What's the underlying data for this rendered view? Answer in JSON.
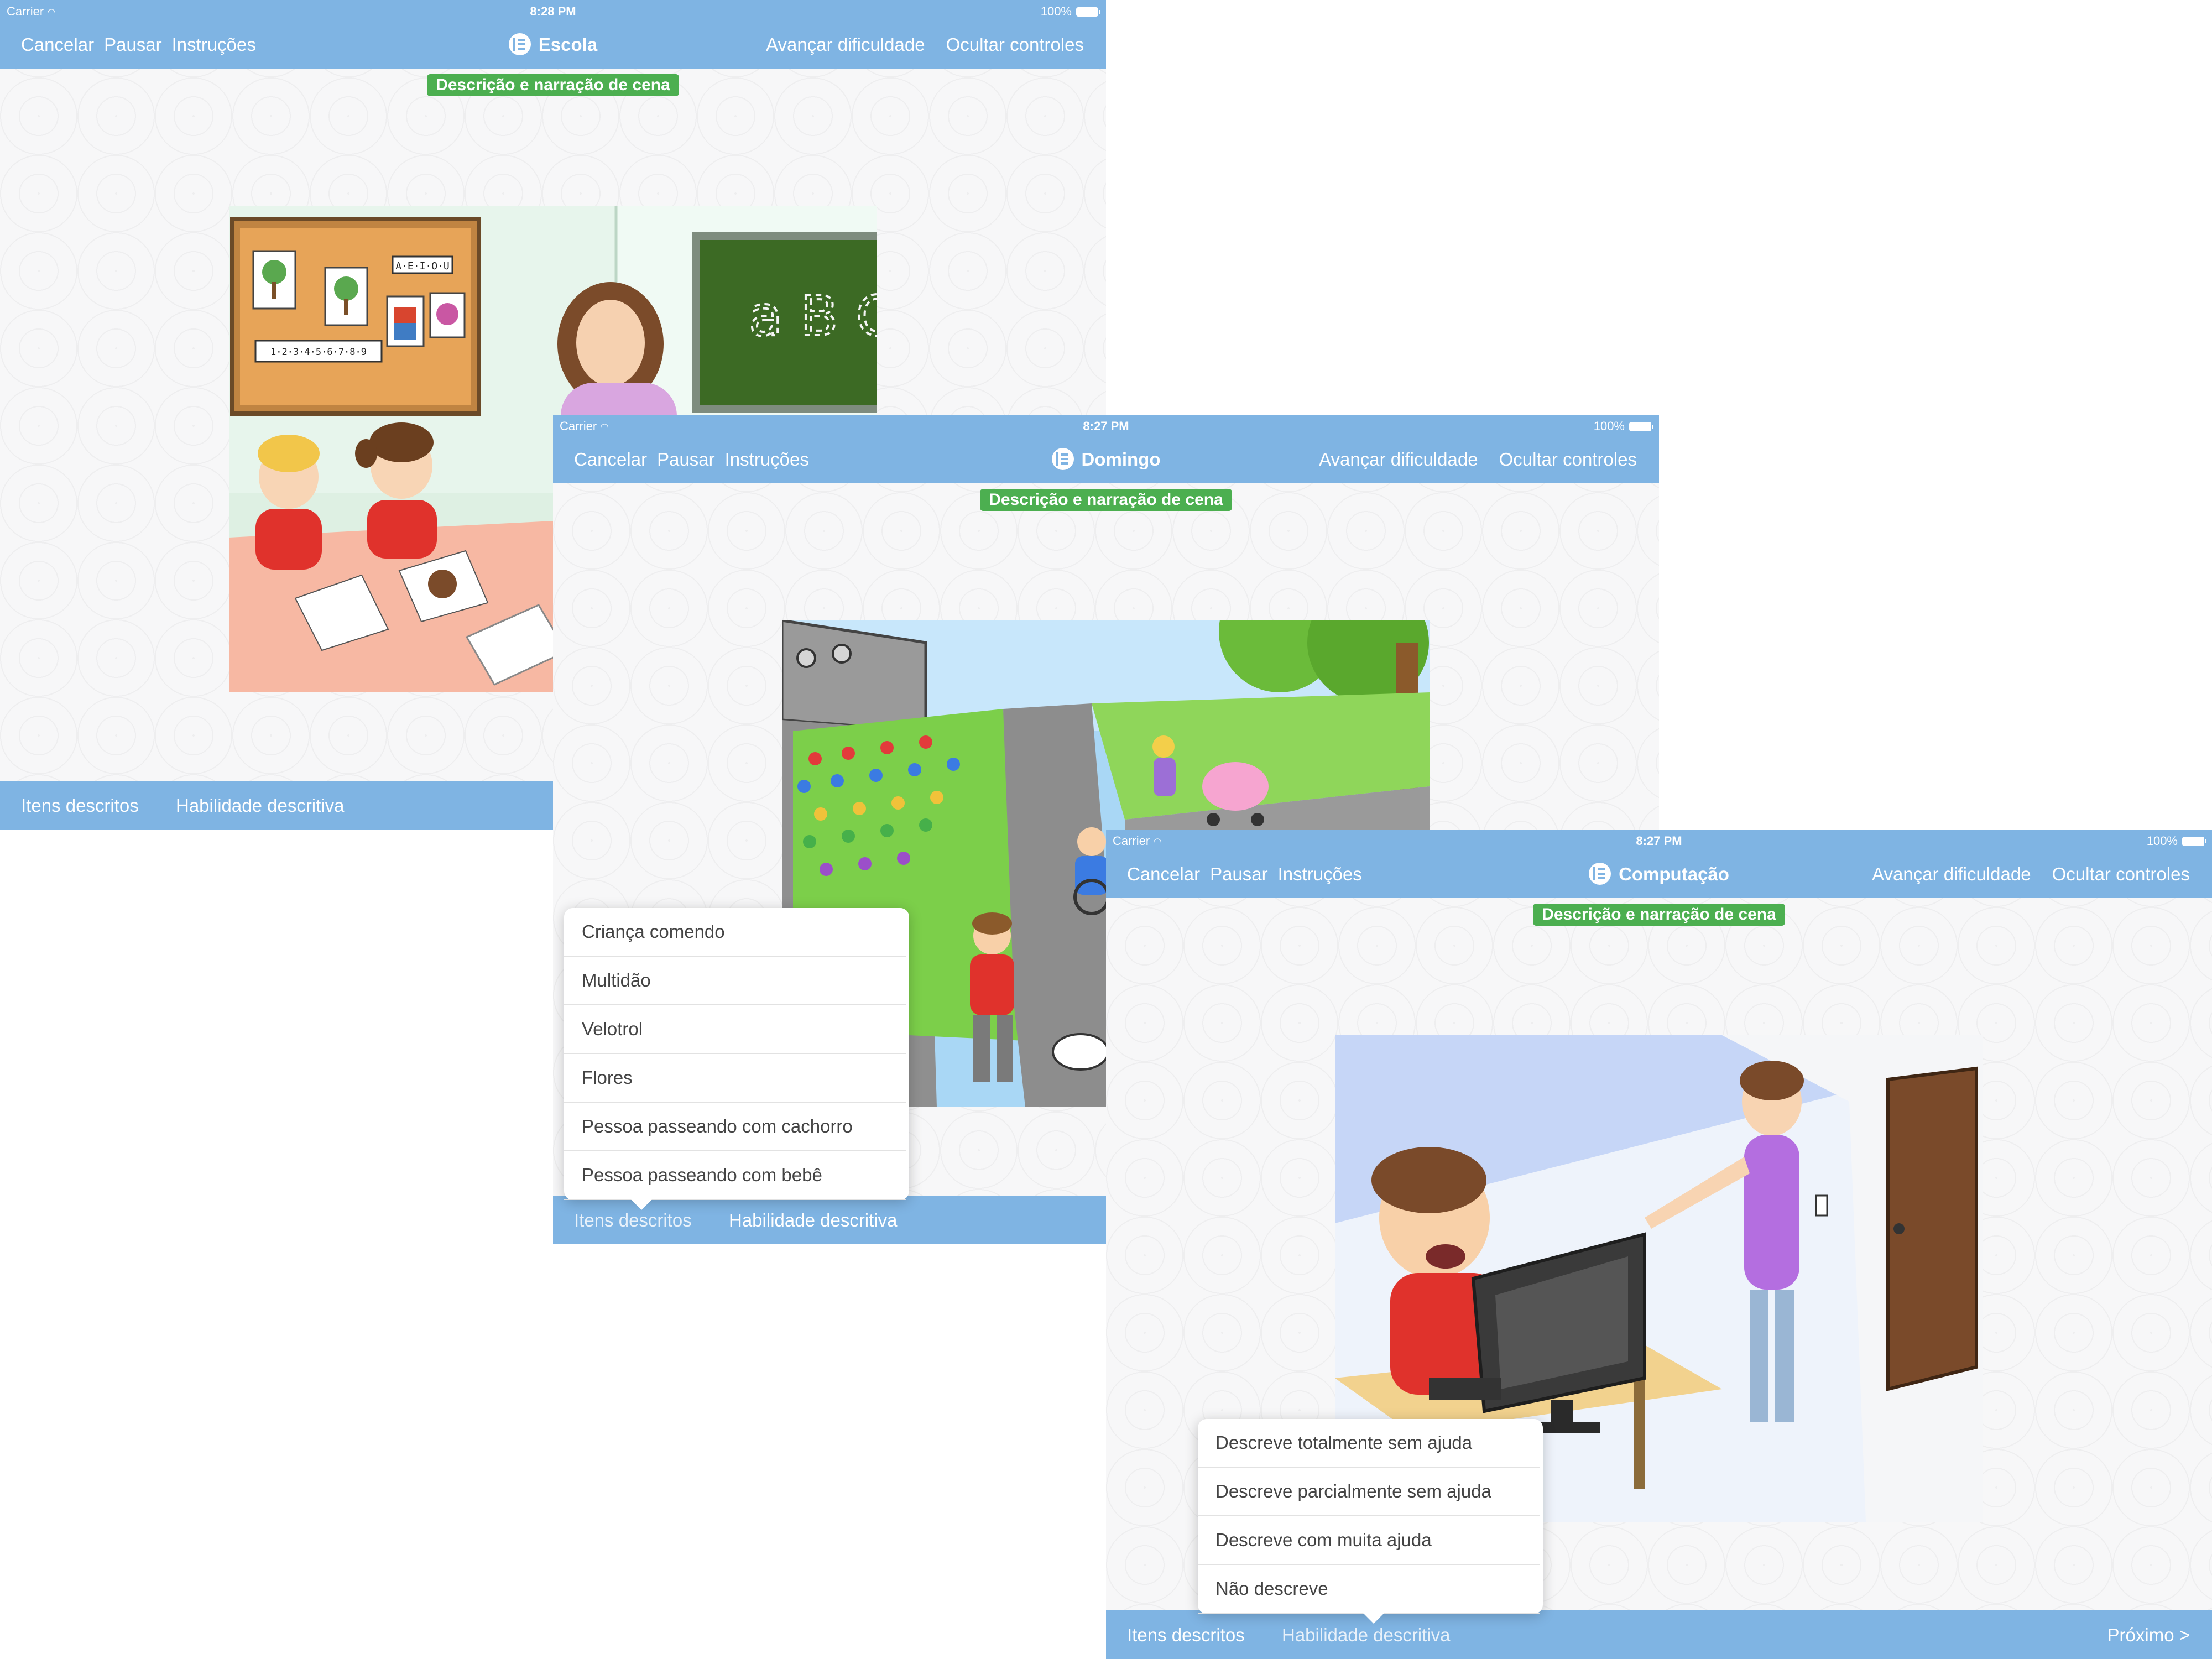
{
  "screens": [
    {
      "status": {
        "carrier": "Carrier",
        "time": "8:28 PM",
        "battery": "100%"
      },
      "nav": {
        "cancel": "Cancelar",
        "pause": "Pausar",
        "instructions": "Instruções",
        "title": "Escola",
        "advance": "Avançar dificuldade",
        "hide": "Ocultar controles"
      },
      "badge": "Descrição e narração de cena",
      "tabs": {
        "items": "Itens descritos",
        "skill": "Habilidade descritiva"
      },
      "scene_text": {
        "alphabet": "A·E·I·O·U",
        "numbers": "1·2·3·4·5·6·7·8·9",
        "board": "a B C"
      }
    },
    {
      "status": {
        "carrier": "Carrier",
        "time": "8:27 PM",
        "battery": "100%"
      },
      "nav": {
        "cancel": "Cancelar",
        "pause": "Pausar",
        "instructions": "Instruções",
        "title": "Domingo",
        "advance": "Avançar dificuldade",
        "hide": "Ocultar controles"
      },
      "badge": "Descrição e narração de cena",
      "tabs": {
        "items": "Itens descritos",
        "skill": "Habilidade descritiva"
      },
      "popover": {
        "options": [
          "Criança comendo",
          "Multidão",
          "Velotrol",
          "Flores",
          "Pessoa passeando com cachorro",
          "Pessoa passeando com bebê"
        ]
      }
    },
    {
      "status": {
        "carrier": "Carrier",
        "time": "8:27 PM",
        "battery": "100%"
      },
      "nav": {
        "cancel": "Cancelar",
        "pause": "Pausar",
        "instructions": "Instruções",
        "title": "Computação",
        "advance": "Avançar dificuldade",
        "hide": "Ocultar controles"
      },
      "badge": "Descrição e narração de cena",
      "tabs": {
        "items": "Itens descritos",
        "skill": "Habilidade descritiva",
        "next": "Próximo >"
      },
      "popover": {
        "options": [
          "Descreve totalmente sem ajuda",
          "Descreve parcialmente sem ajuda",
          "Descreve com muita ajuda",
          "Não descreve"
        ]
      }
    }
  ],
  "colors": {
    "bar": "#7fb4e3",
    "badge": "#4caf50"
  },
  "icons": [
    "wifi-icon",
    "battery-icon",
    "app-logo-icon",
    "popover-arrow-icon"
  ]
}
